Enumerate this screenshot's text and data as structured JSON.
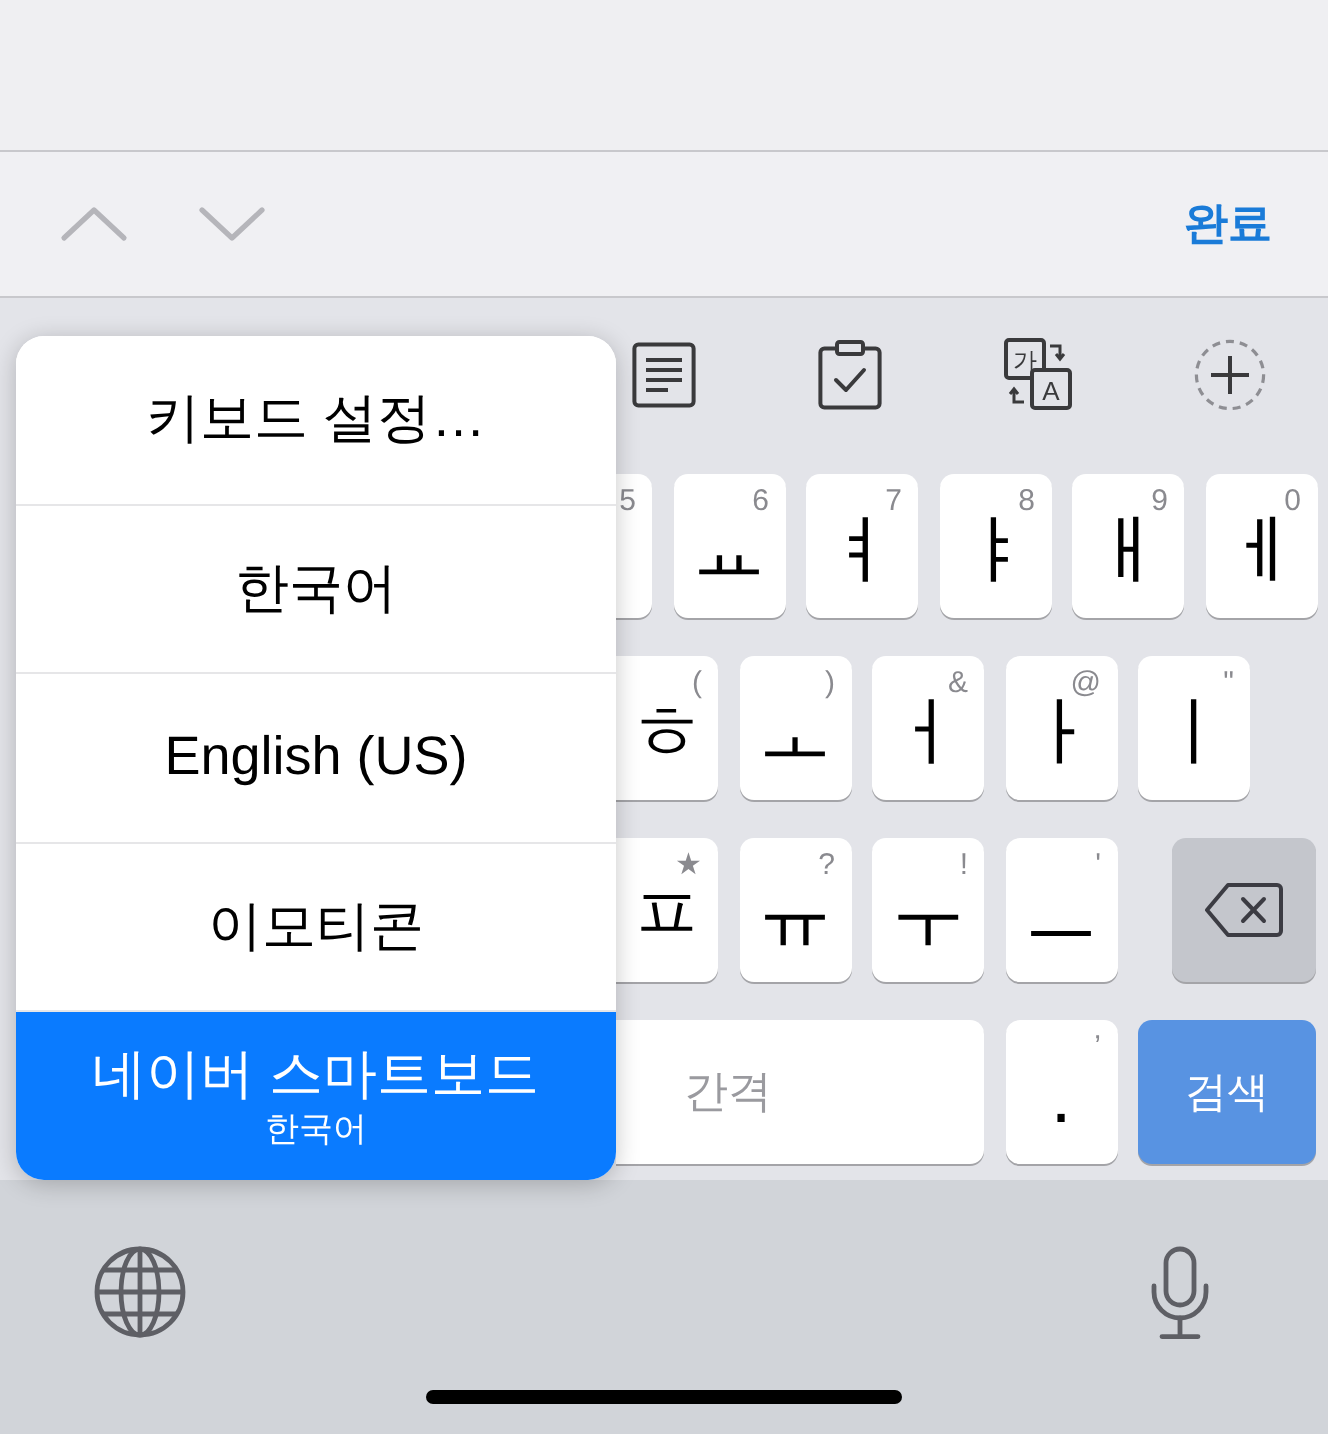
{
  "accessory_bar": {
    "nav": [
      {
        "kind": "up",
        "disabled": true
      },
      {
        "kind": "down",
        "disabled": true
      }
    ],
    "done": "완료"
  },
  "toolbar": [
    {
      "kind": "notes"
    },
    {
      "kind": "clipboard"
    },
    {
      "kind": "translate",
      "glyphs": [
        "가",
        "A"
      ]
    },
    {
      "kind": "add"
    }
  ],
  "menu": {
    "items": [
      {
        "label": "키보드 설정…",
        "selected": false
      },
      {
        "label": "한국어",
        "selected": false
      },
      {
        "label": "English (US)",
        "selected": false
      },
      {
        "label": "이모티콘",
        "selected": false
      },
      {
        "label": "네이버 스마트보드",
        "sublabel": "한국어",
        "selected": true
      }
    ]
  },
  "keyboard": {
    "key_rows": [
      {
        "keys": [
          {
            "kind": "letter",
            "hint": "5"
          },
          {
            "kind": "letter",
            "label": "ㅛ",
            "hint": "6"
          },
          {
            "kind": "letter",
            "label": "ㅕ",
            "hint": "7"
          },
          {
            "kind": "letter",
            "label": "ㅑ",
            "hint": "8"
          },
          {
            "kind": "letter",
            "label": "ㅐ",
            "hint": "9"
          },
          {
            "kind": "letter",
            "label": "ㅔ",
            "hint": "0"
          }
        ]
      },
      {
        "keys": [
          {
            "kind": "letter",
            "label": "ㅎ",
            "hint": "("
          },
          {
            "kind": "letter",
            "label": "ㅗ",
            "hint": ")"
          },
          {
            "kind": "letter",
            "label": "ㅓ",
            "hint": "&"
          },
          {
            "kind": "letter",
            "label": "ㅏ",
            "hint": "@"
          },
          {
            "kind": "letter",
            "label": "ㅣ",
            "hint": "\""
          }
        ]
      },
      {
        "keys": [
          {
            "kind": "letter",
            "label": "ㅍ",
            "hint": "★"
          },
          {
            "kind": "letter",
            "label": "ㅠ",
            "hint": "?"
          },
          {
            "kind": "letter",
            "label": "ㅜ",
            "hint": "!"
          },
          {
            "kind": "letter",
            "label": "ㅡ",
            "hint": "'"
          },
          {
            "kind": "delete"
          }
        ]
      },
      {
        "keys": [
          {
            "kind": "space",
            "label": "간격"
          },
          {
            "kind": "letter",
            "label": ".",
            "hint": "’"
          },
          {
            "kind": "return",
            "label": "검색"
          }
        ]
      }
    ]
  }
}
